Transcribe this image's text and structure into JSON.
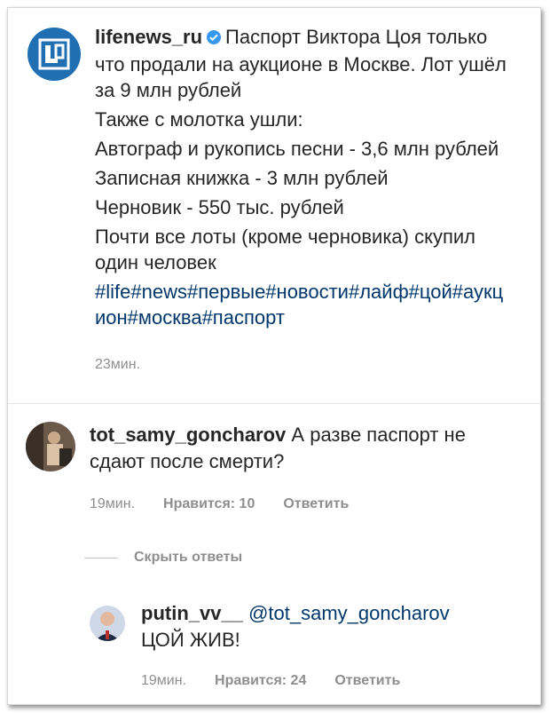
{
  "post": {
    "username": "lifenews_ru",
    "lines": [
      "Паспорт Виктора Цоя только что продали на аукционе в Москве. Лот ушёл за 9 млн рублей",
      "Также с молотка ушли:",
      "Автограф и рукопись песни - 3,6 млн рублей",
      "Записная книжка - 3 млн рублей",
      "Черновик - 550 тыс. рублей",
      "Почти все лоты (кроме черновика) скупил один человек"
    ],
    "hashtags": "#life#news#первые#новости#лайф#цой#аукцион#москва#паспорт",
    "time": "23мин."
  },
  "comment1": {
    "username": "tot_samy_goncharov",
    "text": "А разве паспорт не сдают после смерти?",
    "time": "19мин.",
    "likes": "Нравится: 10",
    "reply": "Ответить"
  },
  "hide_replies": "Скрыть ответы",
  "comment2": {
    "username": "putin_vv__",
    "mention": "@tot_samy_goncharov",
    "text": "ЦОЙ ЖИВ!",
    "time": "19мин.",
    "likes": "Нравится: 24",
    "reply": "Ответить"
  },
  "colors": {
    "link": "#00376b",
    "verified": "#3897f0",
    "muted": "#8e8e8e",
    "brand": "#1f6fb2"
  }
}
